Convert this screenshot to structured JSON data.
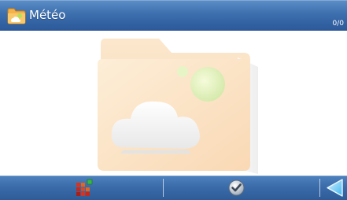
{
  "window": {
    "title": "Météo",
    "page_counter": "0/0",
    "icon": "weather-folder-icon"
  },
  "content": {
    "background_icon": "weather-folder-watermark-icon"
  },
  "toolbar": {
    "buttons": [
      {
        "icon": "category-grid-icon"
      },
      {
        "icon": "checkmark-icon"
      },
      {
        "icon": "back-arrow-icon"
      }
    ]
  },
  "colors": {
    "titlebar_top": "#5c8ec8",
    "titlebar_bottom": "#2b5899",
    "toolbar": "#3a6aa8",
    "folder_orange": "#f5a33a",
    "sun_green": "#a8d64c"
  }
}
